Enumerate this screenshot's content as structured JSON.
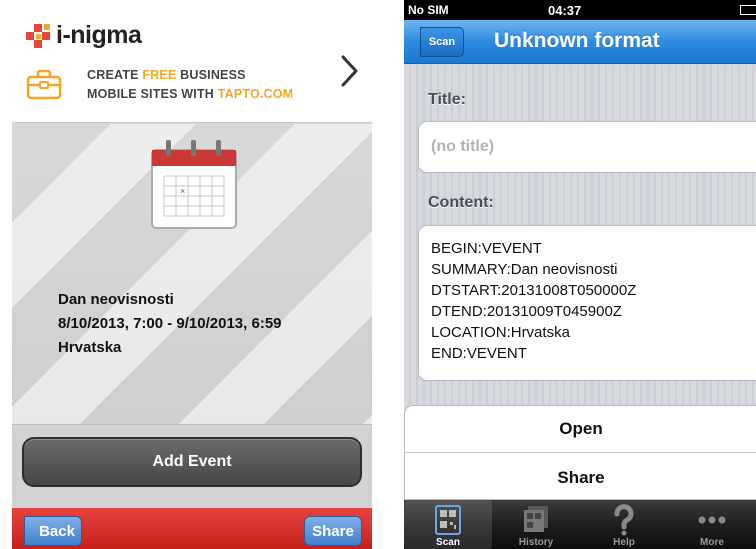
{
  "left": {
    "brand": "i-nigma",
    "promo": {
      "line1_pre": "CREATE ",
      "line1_hl": "FREE",
      "line1_post": " BUSINESS",
      "line2_pre": "MOBILE SITES WITH ",
      "line2_hl": "TAPTO.COM"
    },
    "event": {
      "summary": "Dan neovisnosti",
      "when": "8/10/2013, 7:00 - 9/10/2013, 6:59",
      "location": "Hrvatska"
    },
    "add_event_label": "Add Event",
    "back_label": "Back",
    "share_label": "Share"
  },
  "right": {
    "status": {
      "carrier": "No SIM",
      "time": "04:37"
    },
    "nav": {
      "back_label": "Scan",
      "title": "Unknown format"
    },
    "title_label": "Title:",
    "title_value": "(no title)",
    "content_label": "Content:",
    "content_lines": [
      "BEGIN:VEVENT",
      "SUMMARY:Dan neovisnosti",
      "DTSTART:20131008T050000Z",
      "DTEND:20131009T045900Z",
      "LOCATION:Hrvatska",
      "END:VEVENT"
    ],
    "actions": [
      "Open",
      "Share"
    ],
    "tabs": [
      {
        "label": "Scan",
        "icon": "qr-code-icon",
        "active": true
      },
      {
        "label": "History",
        "icon": "history-icon",
        "active": false
      },
      {
        "label": "Help",
        "icon": "question-mark-icon",
        "active": false
      },
      {
        "label": "More",
        "icon": "more-dots-icon",
        "active": false
      }
    ]
  },
  "colors": {
    "brand_orange": "#f5a623",
    "toolbar_red": "#c61f1a",
    "nav_blue": "#2f8be0"
  }
}
